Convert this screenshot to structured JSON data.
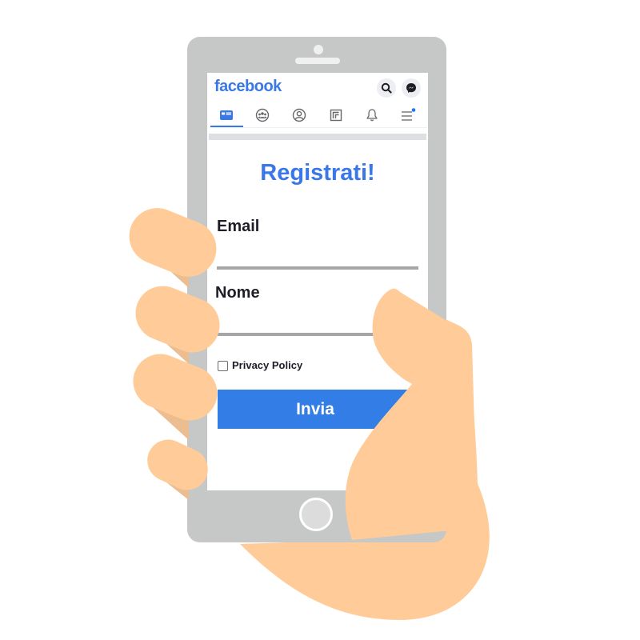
{
  "app": {
    "brand": "facebook",
    "accent_color": "#3b78e7",
    "header_buttons": [
      {
        "icon": "search-icon"
      },
      {
        "icon": "messenger-icon"
      }
    ],
    "nav_tabs": [
      {
        "icon": "news-feed-icon",
        "active": true
      },
      {
        "icon": "groups-icon",
        "active": false
      },
      {
        "icon": "profile-icon",
        "active": false
      },
      {
        "icon": "gaming-icon",
        "active": false
      },
      {
        "icon": "bell-icon",
        "active": false
      },
      {
        "icon": "menu-icon",
        "active": false,
        "has_notification_dot": true
      }
    ]
  },
  "form": {
    "title": "Registrati!",
    "fields": [
      {
        "label": "Email",
        "value": ""
      },
      {
        "label": "Nome",
        "value": ""
      }
    ],
    "checkbox": {
      "label": "Privacy Policy",
      "checked": false
    },
    "submit_label": "Invia",
    "submit_color": "#337de6"
  },
  "illustration": {
    "skin_color": "#ffcc99",
    "shadow_color": "#ebbd90",
    "phone_color": "#c6c7c7"
  }
}
